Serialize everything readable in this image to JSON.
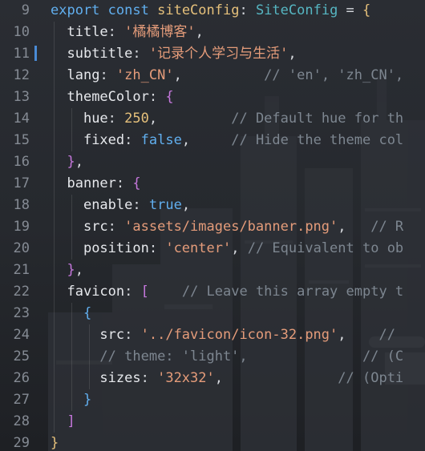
{
  "editor": {
    "lines": [
      {
        "num": "9",
        "tokens": [
          [
            "kw2",
            "export"
          ],
          [
            "punc",
            " "
          ],
          [
            "kw2",
            "const"
          ],
          [
            "punc",
            " "
          ],
          [
            "var",
            "siteConfig"
          ],
          [
            "punc",
            ": "
          ],
          [
            "typ",
            "SiteConfig"
          ],
          [
            "punc",
            " = "
          ],
          [
            "brk1",
            "{"
          ]
        ]
      },
      {
        "num": "10",
        "tokens": [
          [
            "punc",
            "  "
          ],
          [
            "prop",
            "title"
          ],
          [
            "punc",
            ": "
          ],
          [
            "str",
            "'橘橘博客'"
          ],
          [
            "punc",
            ","
          ]
        ]
      },
      {
        "num": "11",
        "tokens": [
          [
            "punc",
            "  "
          ],
          [
            "prop",
            "subtitle"
          ],
          [
            "punc",
            ": "
          ],
          [
            "str",
            "'记录个人学习与生活'"
          ],
          [
            "punc",
            ","
          ]
        ]
      },
      {
        "num": "12",
        "tokens": [
          [
            "punc",
            "  "
          ],
          [
            "prop",
            "lang"
          ],
          [
            "punc",
            ": "
          ],
          [
            "str",
            "'zh_CN'"
          ],
          [
            "punc",
            ",          "
          ],
          [
            "cmt",
            "// 'en', 'zh_CN',"
          ]
        ]
      },
      {
        "num": "13",
        "tokens": [
          [
            "punc",
            "  "
          ],
          [
            "prop",
            "themeColor"
          ],
          [
            "punc",
            ": "
          ],
          [
            "brk2",
            "{"
          ]
        ]
      },
      {
        "num": "14",
        "tokens": [
          [
            "punc",
            "    "
          ],
          [
            "prop",
            "hue"
          ],
          [
            "punc",
            ": "
          ],
          [
            "num",
            "250"
          ],
          [
            "punc",
            ",         "
          ],
          [
            "cmt",
            "// Default hue for th"
          ]
        ]
      },
      {
        "num": "15",
        "tokens": [
          [
            "punc",
            "    "
          ],
          [
            "prop",
            "fixed"
          ],
          [
            "punc",
            ": "
          ],
          [
            "bool",
            "false"
          ],
          [
            "punc",
            ",     "
          ],
          [
            "cmt",
            "// Hide the theme col"
          ]
        ]
      },
      {
        "num": "16",
        "tokens": [
          [
            "punc",
            "  "
          ],
          [
            "brk2",
            "}"
          ],
          [
            "punc",
            ","
          ]
        ]
      },
      {
        "num": "17",
        "tokens": [
          [
            "punc",
            "  "
          ],
          [
            "prop",
            "banner"
          ],
          [
            "punc",
            ": "
          ],
          [
            "brk2",
            "{"
          ]
        ]
      },
      {
        "num": "18",
        "tokens": [
          [
            "punc",
            "    "
          ],
          [
            "prop",
            "enable"
          ],
          [
            "punc",
            ": "
          ],
          [
            "bool",
            "true"
          ],
          [
            "punc",
            ","
          ]
        ]
      },
      {
        "num": "19",
        "tokens": [
          [
            "punc",
            "    "
          ],
          [
            "prop",
            "src"
          ],
          [
            "punc",
            ": "
          ],
          [
            "str",
            "'assets/images/banner.png'"
          ],
          [
            "punc",
            ",   "
          ],
          [
            "cmt",
            "// R"
          ]
        ]
      },
      {
        "num": "20",
        "tokens": [
          [
            "punc",
            "    "
          ],
          [
            "prop",
            "position"
          ],
          [
            "punc",
            ": "
          ],
          [
            "str",
            "'center'"
          ],
          [
            "punc",
            ", "
          ],
          [
            "cmt",
            "// Equivalent to ob"
          ]
        ]
      },
      {
        "num": "21",
        "tokens": [
          [
            "punc",
            "  "
          ],
          [
            "brk2",
            "}"
          ],
          [
            "punc",
            ","
          ]
        ]
      },
      {
        "num": "22",
        "tokens": [
          [
            "punc",
            "  "
          ],
          [
            "prop",
            "favicon"
          ],
          [
            "punc",
            ": "
          ],
          [
            "brk2",
            "["
          ],
          [
            "punc",
            "    "
          ],
          [
            "cmt",
            "// Leave this array empty t"
          ]
        ]
      },
      {
        "num": "23",
        "tokens": [
          [
            "punc",
            "    "
          ],
          [
            "brk3",
            "{"
          ]
        ]
      },
      {
        "num": "24",
        "tokens": [
          [
            "punc",
            "      "
          ],
          [
            "prop",
            "src"
          ],
          [
            "punc",
            ": "
          ],
          [
            "str",
            "'../favicon/icon-32.png'"
          ],
          [
            "punc",
            ",    "
          ],
          [
            "cmt",
            "//"
          ]
        ]
      },
      {
        "num": "25",
        "tokens": [
          [
            "punc",
            "      "
          ],
          [
            "cmt",
            "// theme: 'light',              // (C"
          ]
        ]
      },
      {
        "num": "26",
        "tokens": [
          [
            "punc",
            "      "
          ],
          [
            "prop",
            "sizes"
          ],
          [
            "punc",
            ": "
          ],
          [
            "str",
            "'32x32'"
          ],
          [
            "punc",
            ",              "
          ],
          [
            "cmt",
            "// (Opti"
          ]
        ]
      },
      {
        "num": "27",
        "tokens": [
          [
            "punc",
            "    "
          ],
          [
            "brk3",
            "}"
          ]
        ]
      },
      {
        "num": "28",
        "tokens": [
          [
            "punc",
            "  "
          ],
          [
            "brk2",
            "]"
          ]
        ]
      },
      {
        "num": "29",
        "tokens": [
          [
            "brk1",
            "}"
          ]
        ]
      }
    ]
  }
}
